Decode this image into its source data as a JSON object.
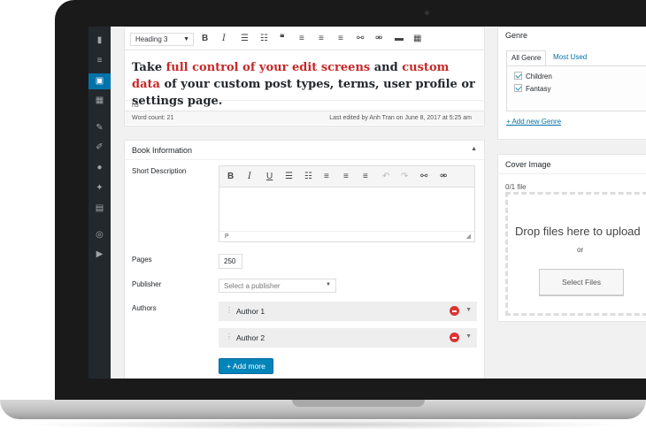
{
  "editor": {
    "format_select": "Heading 3",
    "toolbar_icons": [
      "bold-icon",
      "italic-icon",
      "bullet-list-icon",
      "numbered-list-icon",
      "blockquote-icon",
      "align-left-icon",
      "align-center-icon",
      "align-right-icon",
      "link-icon",
      "unlink-icon",
      "read-more-icon",
      "toolbar-toggle-icon"
    ],
    "content": {
      "part1": "Take ",
      "highlight1": "full control of your edit screens",
      "part2": " and ",
      "highlight2": "custom data",
      "part3": " of your custom post types, terms, user profile or settings page."
    },
    "path": "h3",
    "word_count": "Word count: 21",
    "last_edited": "Last edited by Anh Tran on June 8, 2017 at 5:25 am"
  },
  "book_info": {
    "title": "Book Information",
    "short_description_label": "Short Description",
    "sd_toolbar_icons": [
      "bold-icon",
      "italic-icon",
      "underline-icon",
      "bullet-list-icon",
      "numbered-list-icon",
      "align-left-icon",
      "align-center-icon",
      "align-right-icon",
      "undo-icon",
      "redo-icon",
      "link-icon",
      "unlink-icon"
    ],
    "sd_path": "P",
    "pages_label": "Pages",
    "pages_value": "250",
    "publisher_label": "Publisher",
    "publisher_placeholder": "Select a publisher",
    "authors_label": "Authors",
    "authors": [
      {
        "name": "Author 1"
      },
      {
        "name": "Author 2"
      }
    ],
    "add_more": "+ Add more"
  },
  "genre": {
    "title": "Genre",
    "tabs": [
      "All Genre",
      "Most Used"
    ],
    "items": [
      {
        "label": "Children",
        "checked": true
      },
      {
        "label": "Fantasy",
        "checked": true
      }
    ],
    "add_new": "+ Add new Genre"
  },
  "cover": {
    "title": "Cover Image",
    "count": "0/1 file",
    "drop_text": "Drop files here to upload",
    "or": "or",
    "select_files": "Select Files"
  },
  "sidebar": {
    "icons": [
      "comments-icon",
      "list-icon",
      "book-icon",
      "calendar-icon",
      "plugins-icon",
      "edit-icon",
      "users-icon",
      "tools-icon",
      "settings-icon",
      "visibility-icon",
      "play-icon"
    ]
  }
}
